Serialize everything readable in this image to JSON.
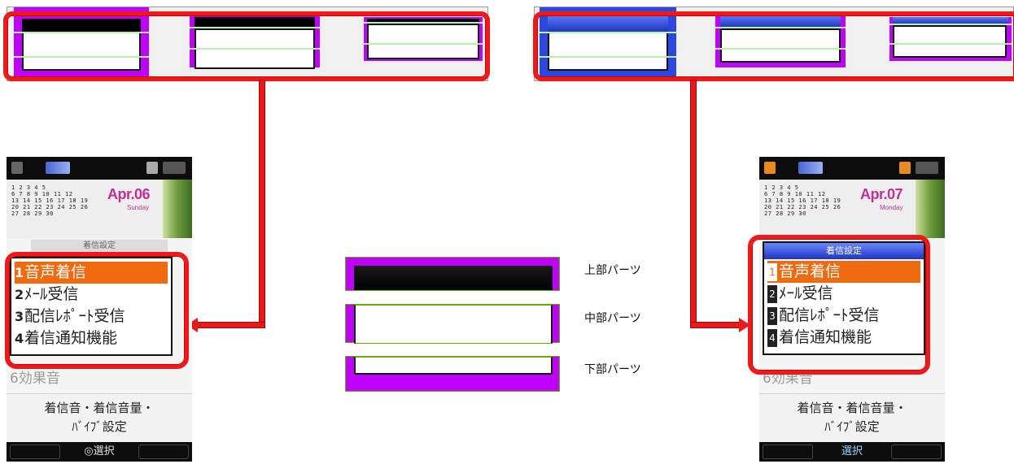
{
  "left_phone": {
    "date": "Apr.06",
    "day": "Sunday",
    "calendar_rows": [
      "  1 2 3 4 5",
      "6 7 8 9 10 11 12",
      "13 14 15 16 17 18 19",
      "20 21 22 23 24 25 26",
      "27 28 29 30"
    ],
    "menu_title": "着信設定",
    "menu_items": [
      {
        "num": "1",
        "label": "音声着信"
      },
      {
        "num": "2",
        "label": "ﾒｰﾙ受信"
      },
      {
        "num": "3",
        "label": "配信ﾚﾎﾟｰﾄ受信"
      },
      {
        "num": "4",
        "label": "着信通知機能"
      }
    ],
    "behind_item": "6効果音",
    "info_text": "着信音・着信音量・",
    "info_text2": "ﾊﾞｲﾌﾞ設定",
    "softkey": "◎選択"
  },
  "right_phone": {
    "date": "Apr.07",
    "day": "Monday",
    "calendar_rows": [
      "  1 2 3 4 5",
      "6 7 8 9 10 11 12",
      "13 14 15 16 17 18 19",
      "20 21 22 23 24 25 26",
      "27 28 29 30"
    ],
    "menu_title": "着信設定",
    "menu_items": [
      {
        "num": "1",
        "label": "音声着信"
      },
      {
        "num": "2",
        "label": "ﾒｰﾙ受信"
      },
      {
        "num": "3",
        "label": "配信ﾚﾎﾟｰﾄ受信"
      },
      {
        "num": "4",
        "label": "着信通知機能"
      }
    ],
    "behind_item": "6効果音",
    "info_text": "着信音・着信音量・",
    "info_text2": "ﾊﾞｲﾌﾞ設定",
    "softkey": "選択"
  },
  "parts": {
    "top": "上部パーツ",
    "middle": "中部パーツ",
    "bottom": "下部パーツ"
  },
  "colors": {
    "highlight": "#e61a1a",
    "padding": "#c000ff",
    "selection": "#f06a10",
    "blue_title": "#2a48e0"
  }
}
